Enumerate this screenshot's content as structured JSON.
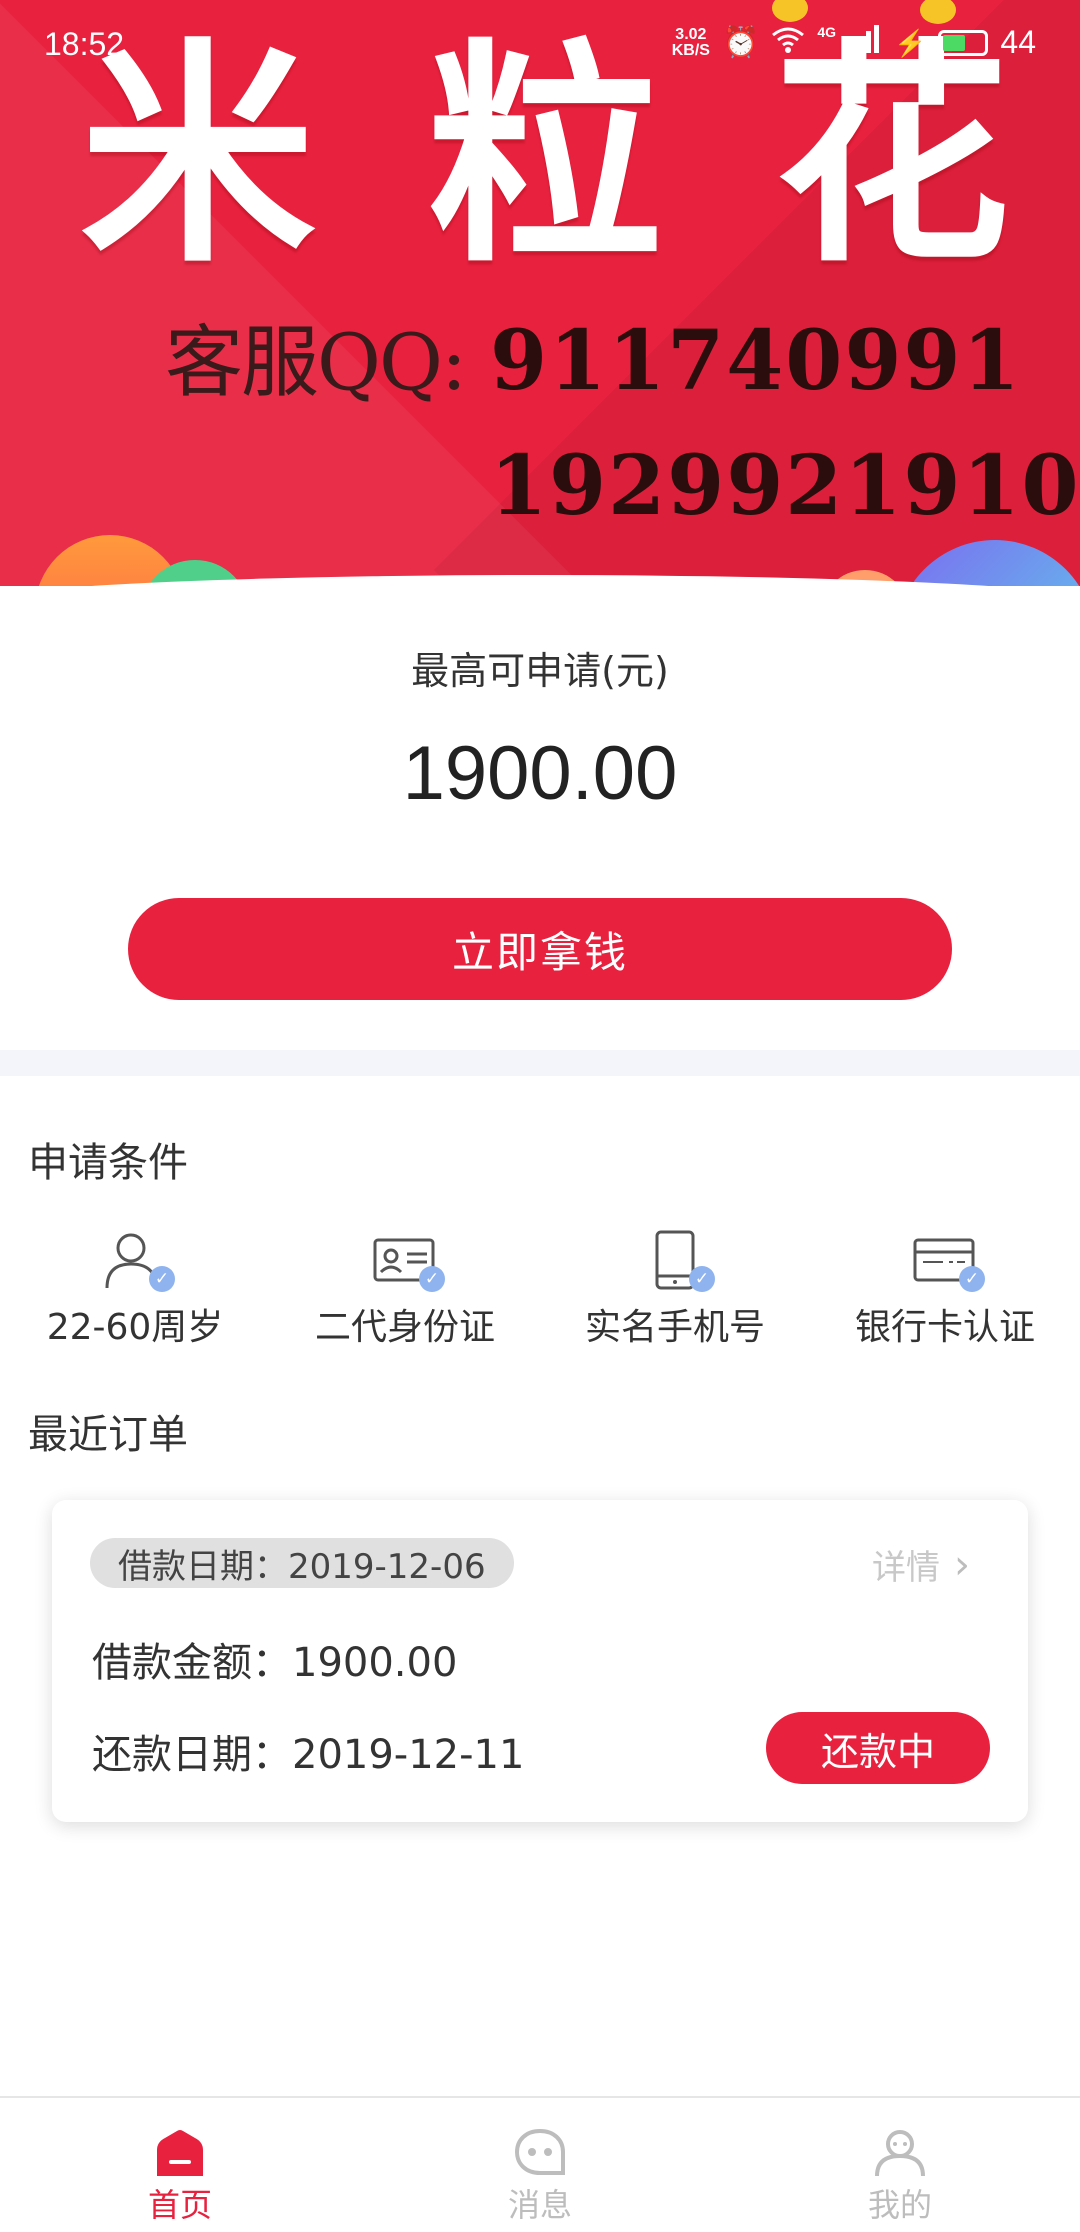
{
  "status_bar": {
    "time": "18:52",
    "net_speed_value": "3.02",
    "net_speed_unit": "KB/S",
    "network": "4G",
    "battery": "44"
  },
  "banner": {
    "logo_chars": [
      "米",
      "粒",
      "花"
    ],
    "qq_label": "客服QQ:",
    "qq_number_1": "911740991",
    "qq_number_2": "1929921910",
    "colors": {
      "background": "#e8213f"
    }
  },
  "loan": {
    "max_label": "最高可申请(元)",
    "max_amount": "1900.00",
    "cta_label": "立即拿钱"
  },
  "conditions": {
    "title": "申请条件",
    "items": [
      {
        "label": "22-60周岁",
        "icon": "person-icon"
      },
      {
        "label": "二代身份证",
        "icon": "id-card-icon"
      },
      {
        "label": "实名手机号",
        "icon": "phone-icon"
      },
      {
        "label": "银行卡认证",
        "icon": "bank-card-icon"
      }
    ]
  },
  "orders": {
    "title": "最近订单",
    "card": {
      "loan_date": "借款日期：2019-12-06",
      "detail_label": "详情",
      "amount": "借款金额：1900.00",
      "repay_date": "还款日期：2019-12-11",
      "status": "还款中"
    }
  },
  "bottom_nav": {
    "items": [
      {
        "label": "首页",
        "icon": "home-icon",
        "active": true
      },
      {
        "label": "消息",
        "icon": "message-icon",
        "active": false
      },
      {
        "label": "我的",
        "icon": "profile-icon",
        "active": false
      }
    ]
  },
  "theme": {
    "accent": "#e8213f",
    "inactive": "#bdbdbd",
    "check": "#8fb3ee"
  }
}
